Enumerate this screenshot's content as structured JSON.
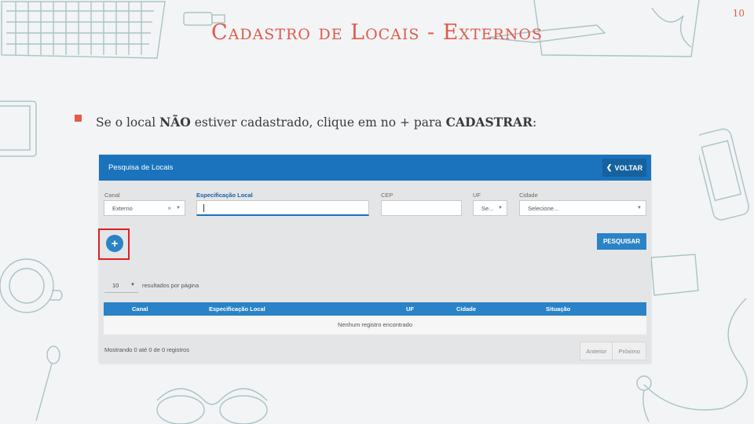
{
  "slide": {
    "title": "Cadastro de Locais - Externos",
    "page_number": "10",
    "bullet_parts": [
      "Se o local ",
      "NÃO",
      " estiver cadastrado, clique em no + para ",
      "CADASTRAR",
      ":"
    ],
    "accent_color": "#e05a4b"
  },
  "screen": {
    "header_title": "Pesquisa de Locais",
    "back_icon": "chevron-left-icon",
    "back_label": "VOLTAR",
    "filters": {
      "canal_label": "Canal",
      "canal_value": "Externo",
      "canal_clear": "×",
      "especificacao_label": "Especificação Local",
      "especificacao_value": "",
      "cep_label": "CEP",
      "cep_value": "",
      "uf_label": "UF",
      "uf_value": "Se...",
      "cidade_label": "Cidade",
      "cidade_value": "Selecione..."
    },
    "add_button_label": "+",
    "search_button_label": "PESQUISAR",
    "page_size_value": "10",
    "per_page_label": "resultados por página",
    "table": {
      "columns": [
        "Canal",
        "Especificação Local",
        "UF",
        "Cidade",
        "Situação"
      ],
      "empty_message": "Nenhum registro encontrado"
    },
    "footer_info": "Mostrando 0 até 0 de 0 registros",
    "pager": {
      "prev": "Anterior",
      "next": "Próximo"
    },
    "primary_color": "#1a73bc",
    "highlight_color": "#e01f1f"
  }
}
